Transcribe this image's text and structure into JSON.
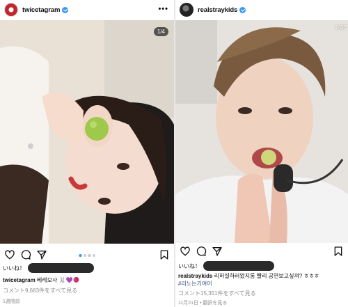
{
  "left_post": {
    "username": "twicetagram",
    "carousel_counter": "1/4",
    "likes_label": "いいね！",
    "caption_user": "twicetagram",
    "caption_text": "베레모사 🐰💜🧶",
    "comments_link": "コメント9,683件をすべて見る",
    "time_ago": "1週間前"
  },
  "right_post": {
    "username": "realstraykids",
    "video_time": "0:07",
    "likes_label": "いいね！",
    "caption_user": "realstraykids",
    "caption_text": "리허설하러왔지롱 빨리 공연보고싶져? ㅎㅎㅎ",
    "caption_tag": "#리노는기여어",
    "comments_link": "コメント15,351件をすべて見る",
    "date": "11月21日",
    "translate_link": "翻訳を見る"
  },
  "colors": {
    "verified": "#3897f0",
    "muted": "#8e8e8e",
    "hashtag": "#385185"
  },
  "icons": [
    "more-icon",
    "heart-icon",
    "comment-icon",
    "share-icon",
    "bookmark-icon",
    "verified-icon"
  ]
}
